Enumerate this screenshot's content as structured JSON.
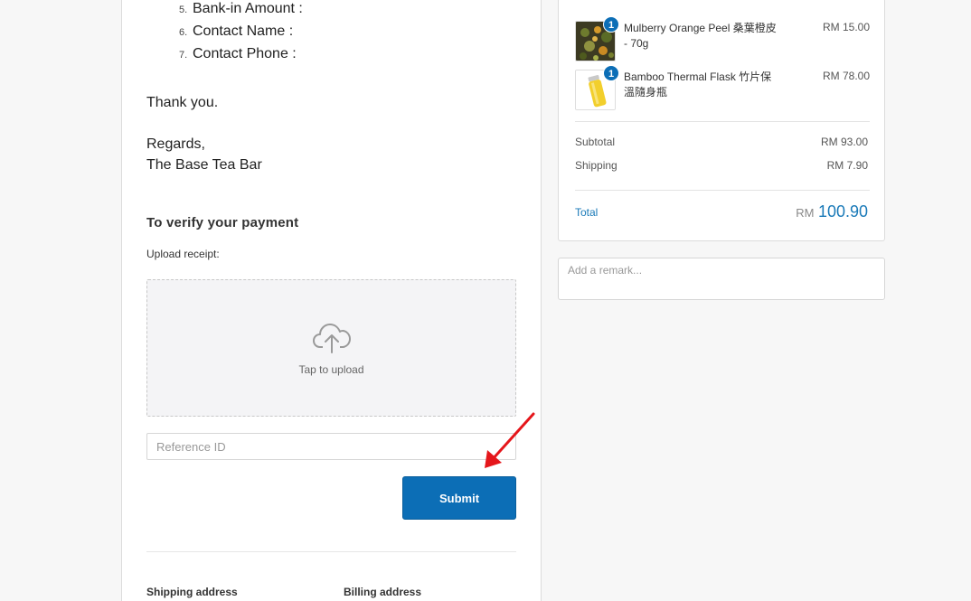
{
  "instructions": {
    "list": [
      {
        "num": "5.",
        "text": "Bank-in Amount :"
      },
      {
        "num": "6.",
        "text": "Contact Name :"
      },
      {
        "num": "7.",
        "text": "Contact Phone :"
      }
    ],
    "thanks": "Thank you.",
    "regards": "Regards,",
    "signature": "The Base Tea Bar"
  },
  "verify": {
    "heading": "To verify your payment",
    "upload_label": "Upload receipt:",
    "upload_hint": "Tap to upload",
    "reference_placeholder": "Reference ID",
    "submit_label": "Submit"
  },
  "addresses": {
    "shipping_label": "Shipping address",
    "billing_label": "Billing address"
  },
  "order_summary": {
    "items": [
      {
        "qty": "1",
        "name": "Mulberry Orange Peel 桑葉橙皮 - 70g",
        "price": "RM 15.00",
        "thumb_icon": "tea-leaves-thumbnail"
      },
      {
        "qty": "1",
        "name": "Bamboo Thermal Flask 竹片保溫隨身瓶",
        "price": "RM 78.00",
        "thumb_icon": "yellow-flask-thumbnail"
      }
    ],
    "subtotal_label": "Subtotal",
    "subtotal_value": "RM 93.00",
    "shipping_label": "Shipping",
    "shipping_value": "RM 7.90",
    "total_label": "Total",
    "total_currency": "RM",
    "total_amount": "100.90"
  },
  "remark": {
    "placeholder": "Add a remark..."
  },
  "colors": {
    "accent": "#0c6eb6",
    "arrow": "#e5161b"
  }
}
